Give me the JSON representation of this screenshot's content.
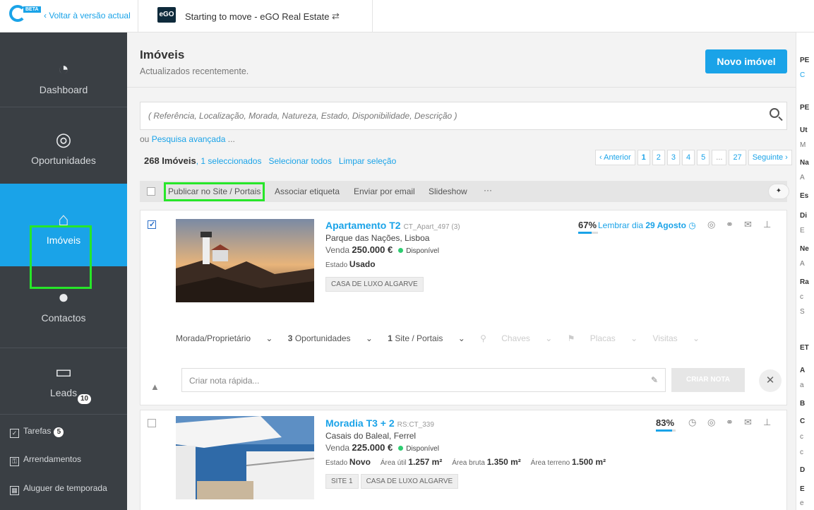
{
  "topbar": {
    "beta_label": "BETA",
    "back_link": "‹ Voltar à versão actual",
    "ego_logo": "eGO",
    "agency_name": "Starting to move - eGO Real Estate",
    "switch_icon": "⇄"
  },
  "sidebar": {
    "items": [
      {
        "label": "Dashboard",
        "icon": "speedometer-icon"
      },
      {
        "label": "Oportunidades",
        "icon": "target-icon"
      },
      {
        "label": "Imóveis",
        "icon": "house-icon"
      },
      {
        "label": "Contactos",
        "icon": "person-icon"
      },
      {
        "label": "Leads",
        "icon": "inbox-icon",
        "badge": "10"
      }
    ],
    "links": [
      {
        "label": "Tarefas",
        "badge": "5",
        "icon": "checkbox-icon"
      },
      {
        "label": "Arrendamentos",
        "icon": "key-icon"
      },
      {
        "label": "Aluguer de temporada",
        "icon": "calendar-icon"
      }
    ]
  },
  "header": {
    "title": "Imóveis",
    "subtitle": "Actualizados recentemente.",
    "new_button": "Novo imóvel"
  },
  "search": {
    "placeholder": "( Referência, Localização, Morada, Natureza, Estado, Disponibilidade, Descrição )",
    "advanced_prefix": "ou",
    "advanced_link": "Pesquisa avançada",
    "advanced_suffix": "..."
  },
  "results": {
    "count": "268 Imóveis",
    "selected": "1 seleccionados",
    "select_all": "Selecionar todos",
    "clear": "Limpar seleção"
  },
  "pagination": {
    "prev": "‹ Anterior",
    "pages": [
      "1",
      "2",
      "3",
      "4",
      "5"
    ],
    "ellipsis": "...",
    "last": "27",
    "next": "Seguinte ›"
  },
  "actions": {
    "publish": "Publicar no Site / Portais",
    "tag": "Associar etiqueta",
    "email": "Enviar por email",
    "slideshow": "Slideshow",
    "more": "···"
  },
  "properties": [
    {
      "title": "Apartamento T2",
      "ref": "CT_Apart_497 (3)",
      "location": "Parque das Nações, Lisboa",
      "deal": "Venda",
      "price": "250.000 €",
      "availability": "Disponível",
      "estado_label": "Estado",
      "estado": "Usado",
      "tags": [
        "CASA DE LUXO ALGARVE"
      ],
      "percent": "67%",
      "percent_value": 0.67,
      "reminder": "Lembrar dia",
      "reminder_date": "29 Agosto",
      "checked": true,
      "owner": "Morada/Proprietário",
      "opps_count": "3",
      "opps_label": "Oportunidades",
      "sites_count": "1",
      "sites_label": "Site / Portais",
      "keys": "Chaves",
      "boards": "Placas",
      "visits": "Visitas",
      "note_placeholder": "Criar nota rápida...",
      "note_button": "CRIAR NOTA"
    },
    {
      "title": "Moradia T3 + 2",
      "ref": "RS:CT_339",
      "location": "Casais do Baleal, Ferrel",
      "deal": "Venda",
      "price": "225.000 €",
      "availability": "Disponível",
      "estado_label": "Estado",
      "estado": "Novo",
      "area_util_label": "Área útil",
      "area_util": "1.257 m²",
      "area_bruta_label": "Área bruta",
      "area_bruta": "1.350 m²",
      "area_terreno_label": "Área terreno",
      "area_terreno": "1.500 m²",
      "tags": [
        "SITE 1",
        "CASA DE LUXO ALGARVE"
      ],
      "percent": "83%",
      "percent_value": 0.83,
      "checked": false
    }
  ],
  "right_panel": {
    "items": [
      "PE",
      "C",
      "PE",
      "Ut",
      "M",
      "Na",
      "A",
      "Es",
      "Di",
      "E",
      "Ne",
      "A",
      "Ra",
      "c",
      "S",
      "ET",
      "A",
      "a",
      "B",
      "C",
      "c",
      "c",
      "D",
      "E",
      "e"
    ]
  },
  "colors": {
    "accent": "#1aa3e8",
    "sidebar": "#3a3f44",
    "highlight": "#27e629"
  }
}
